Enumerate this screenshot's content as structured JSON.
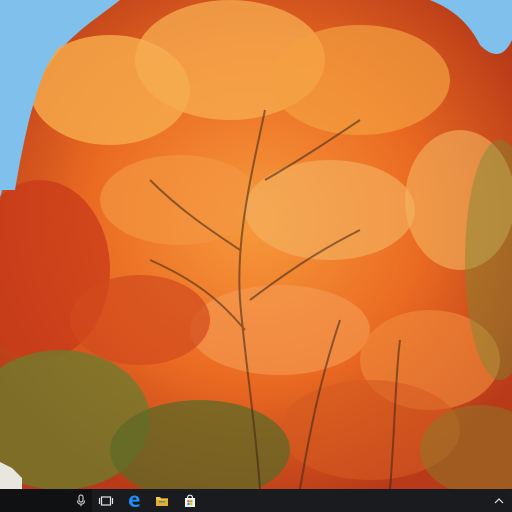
{
  "colors": {
    "taskbar_bg": "#1a1b1f",
    "search_bg": "#101113",
    "sky": "#7fc0ec",
    "foliage_orange": "#f07a2a",
    "foliage_red": "#c83a1a",
    "foliage_yellow": "#f6b24a",
    "foliage_green": "#6f7a2c",
    "edge_blue": "#1e90ff",
    "explorer_yellow": "#f3c64a"
  },
  "taskbar": {
    "search_icon": "microphone-icon",
    "pinned": [
      {
        "name": "task-view",
        "icon": "task-view-icon"
      },
      {
        "name": "edge",
        "icon": "edge-icon"
      },
      {
        "name": "file-explorer",
        "icon": "folder-icon"
      },
      {
        "name": "store",
        "icon": "store-icon"
      }
    ],
    "tray_icon": "chevron-up-icon"
  }
}
